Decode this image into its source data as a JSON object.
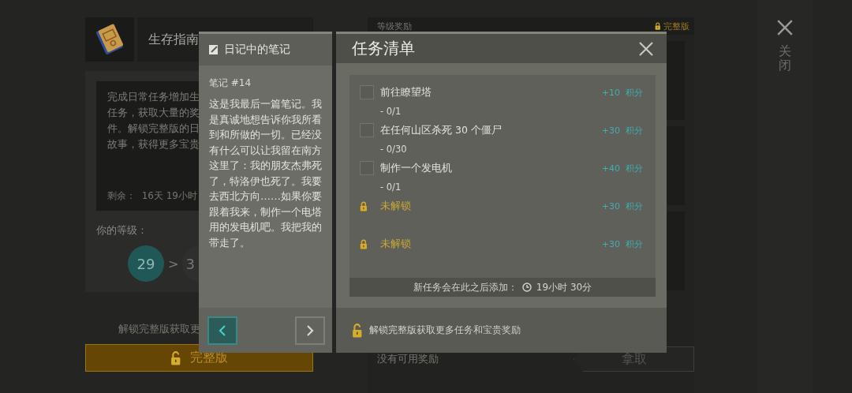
{
  "guide_panel": {
    "title": "生存指南",
    "description_lines": [
      "完成日常任务增加生",
      "任务，获取大量的奖",
      "件。解锁完整版的日",
      "故事，获得更多宝贵"
    ],
    "remaining": "剩余：  16天 19小时",
    "level_label": "你的等级：",
    "current_level": "29",
    "separator": ">",
    "next_level": "3",
    "unlock_hint": "解锁完整版获取更",
    "unlock_button": "完整版"
  },
  "rewards_panel": {
    "title": "等级奖励",
    "badge": "完整版",
    "status": "没有可用奖励",
    "claim_button": "拿取"
  },
  "close": {
    "label": "关闭"
  },
  "note_dialog": {
    "title": "日记中的笔记",
    "heading": "笔记 #14",
    "body": "这是我最后一篇笔记。我是真诚地想告诉你我所看到和所做的一切。已经没有什么可以让我留在南方这里了：我的朋友杰弗死了，特洛伊也死了。我要去西北方向……如果你要跟着我来，制作一个电塔用的发电机吧。我把我的带走了。",
    "nav_buttons": [
      {
        "kind": "previous",
        "selected": true
      },
      {
        "kind": "next",
        "selected": false
      }
    ]
  },
  "task_dialog": {
    "title": "任务清单",
    "tasks": [
      {
        "kind": "task",
        "checked": false,
        "name": "前往瞭望塔",
        "progress": "- 0/1",
        "reward": "+10  积分"
      },
      {
        "kind": "task",
        "checked": false,
        "name": "在任何山区杀死 30 个僵尸",
        "progress": "- 0/30",
        "reward": "+30  积分"
      },
      {
        "kind": "task",
        "checked": false,
        "name": "制作一个发电机",
        "progress": "- 0/1",
        "reward": "+40  积分"
      },
      {
        "kind": "locked",
        "name": "未解锁",
        "reward": "+30  积分"
      },
      {
        "kind": "locked",
        "name": "未解锁",
        "reward": "+30  积分"
      }
    ],
    "timer_label": "新任务会在此之后添加：",
    "timer": "19小时 30分",
    "footer": "解锁完整版获取更多任务和宝贵奖励"
  }
}
